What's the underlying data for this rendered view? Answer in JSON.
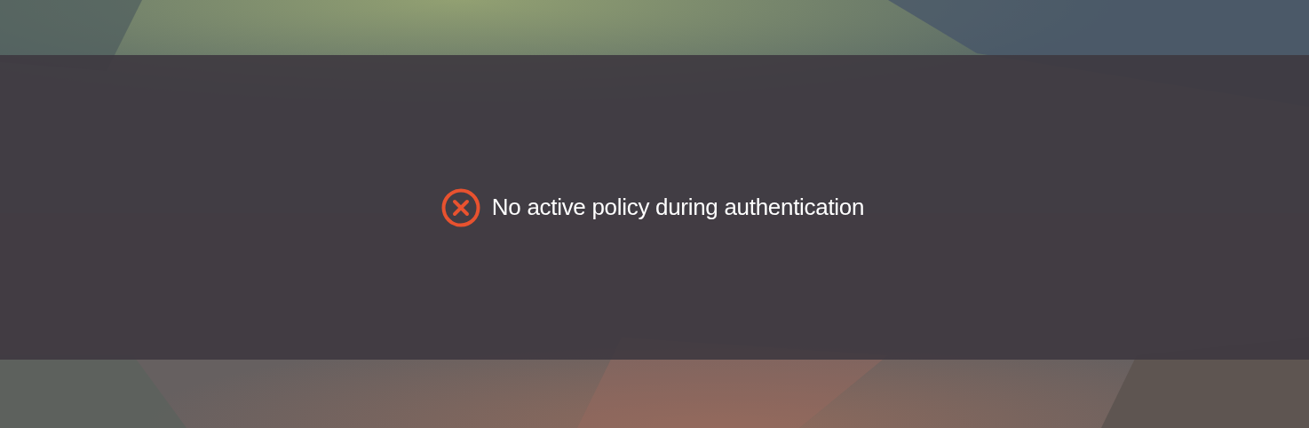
{
  "message": {
    "kind": "error",
    "text": "No active policy during authentication"
  }
}
